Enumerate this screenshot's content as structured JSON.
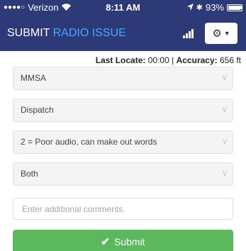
{
  "status_bar": {
    "signal_dots": "●●●●○",
    "carrier": "Verizon",
    "time": "8:11 AM",
    "battery": "93%"
  },
  "header": {
    "title_part1": "SUBMIT",
    "title_part2": "RADIO ISSUE",
    "accent_color": "#3fa9ff",
    "background_color": "#2e3a78",
    "menu_button_icon": "gear-icon"
  },
  "locate": {
    "last_locate_label": "Last Locate:",
    "last_locate_value": "00:00",
    "separator": "|",
    "accuracy_label": "Accuracy:",
    "accuracy_value": "656 ft"
  },
  "form": {
    "selects": [
      {
        "value": "MMSA"
      },
      {
        "value": "Dispatch"
      },
      {
        "value": "2 = Poor audio, can make out words"
      },
      {
        "value": "Both"
      }
    ],
    "comments_placeholder": "Enter additional comments.",
    "submit_label": "Submit",
    "submit_color": "#5cb85c"
  }
}
